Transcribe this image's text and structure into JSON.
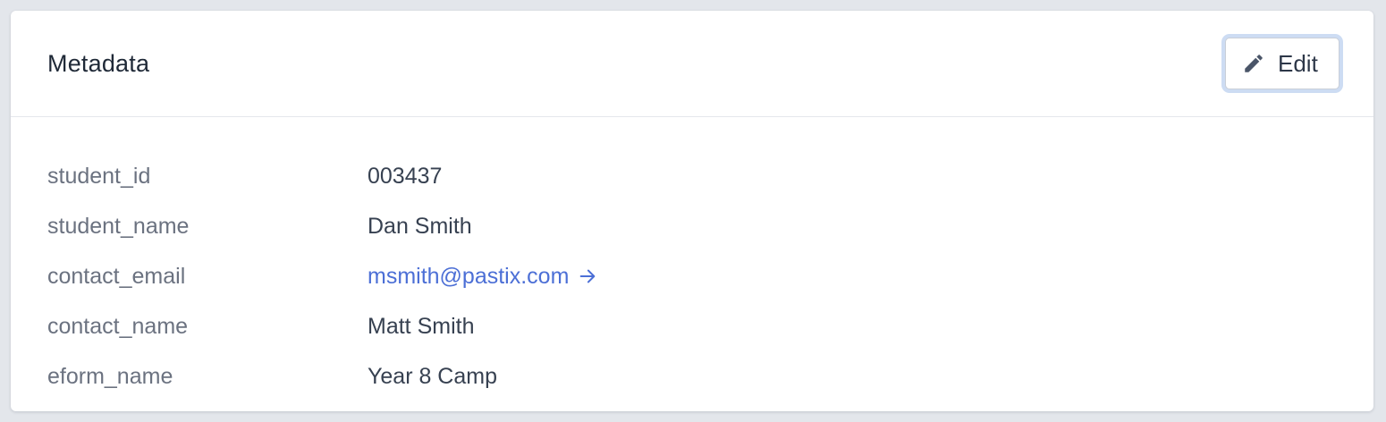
{
  "card": {
    "title": "Metadata",
    "edit_label": "Edit"
  },
  "rows": [
    {
      "key": "student_id",
      "value": "003437"
    },
    {
      "key": "student_name",
      "value": "Dan Smith"
    },
    {
      "key": "contact_email",
      "value": "msmith@pastix.com"
    },
    {
      "key": "contact_name",
      "value": "Matt Smith"
    },
    {
      "key": "eform_name",
      "value": "Year 8 Camp"
    }
  ],
  "icons": {
    "edit": "pencil-icon",
    "link": "arrow-right-icon"
  },
  "colors": {
    "link": "#4c6fd6",
    "focus_ring": "#cddcf3"
  }
}
